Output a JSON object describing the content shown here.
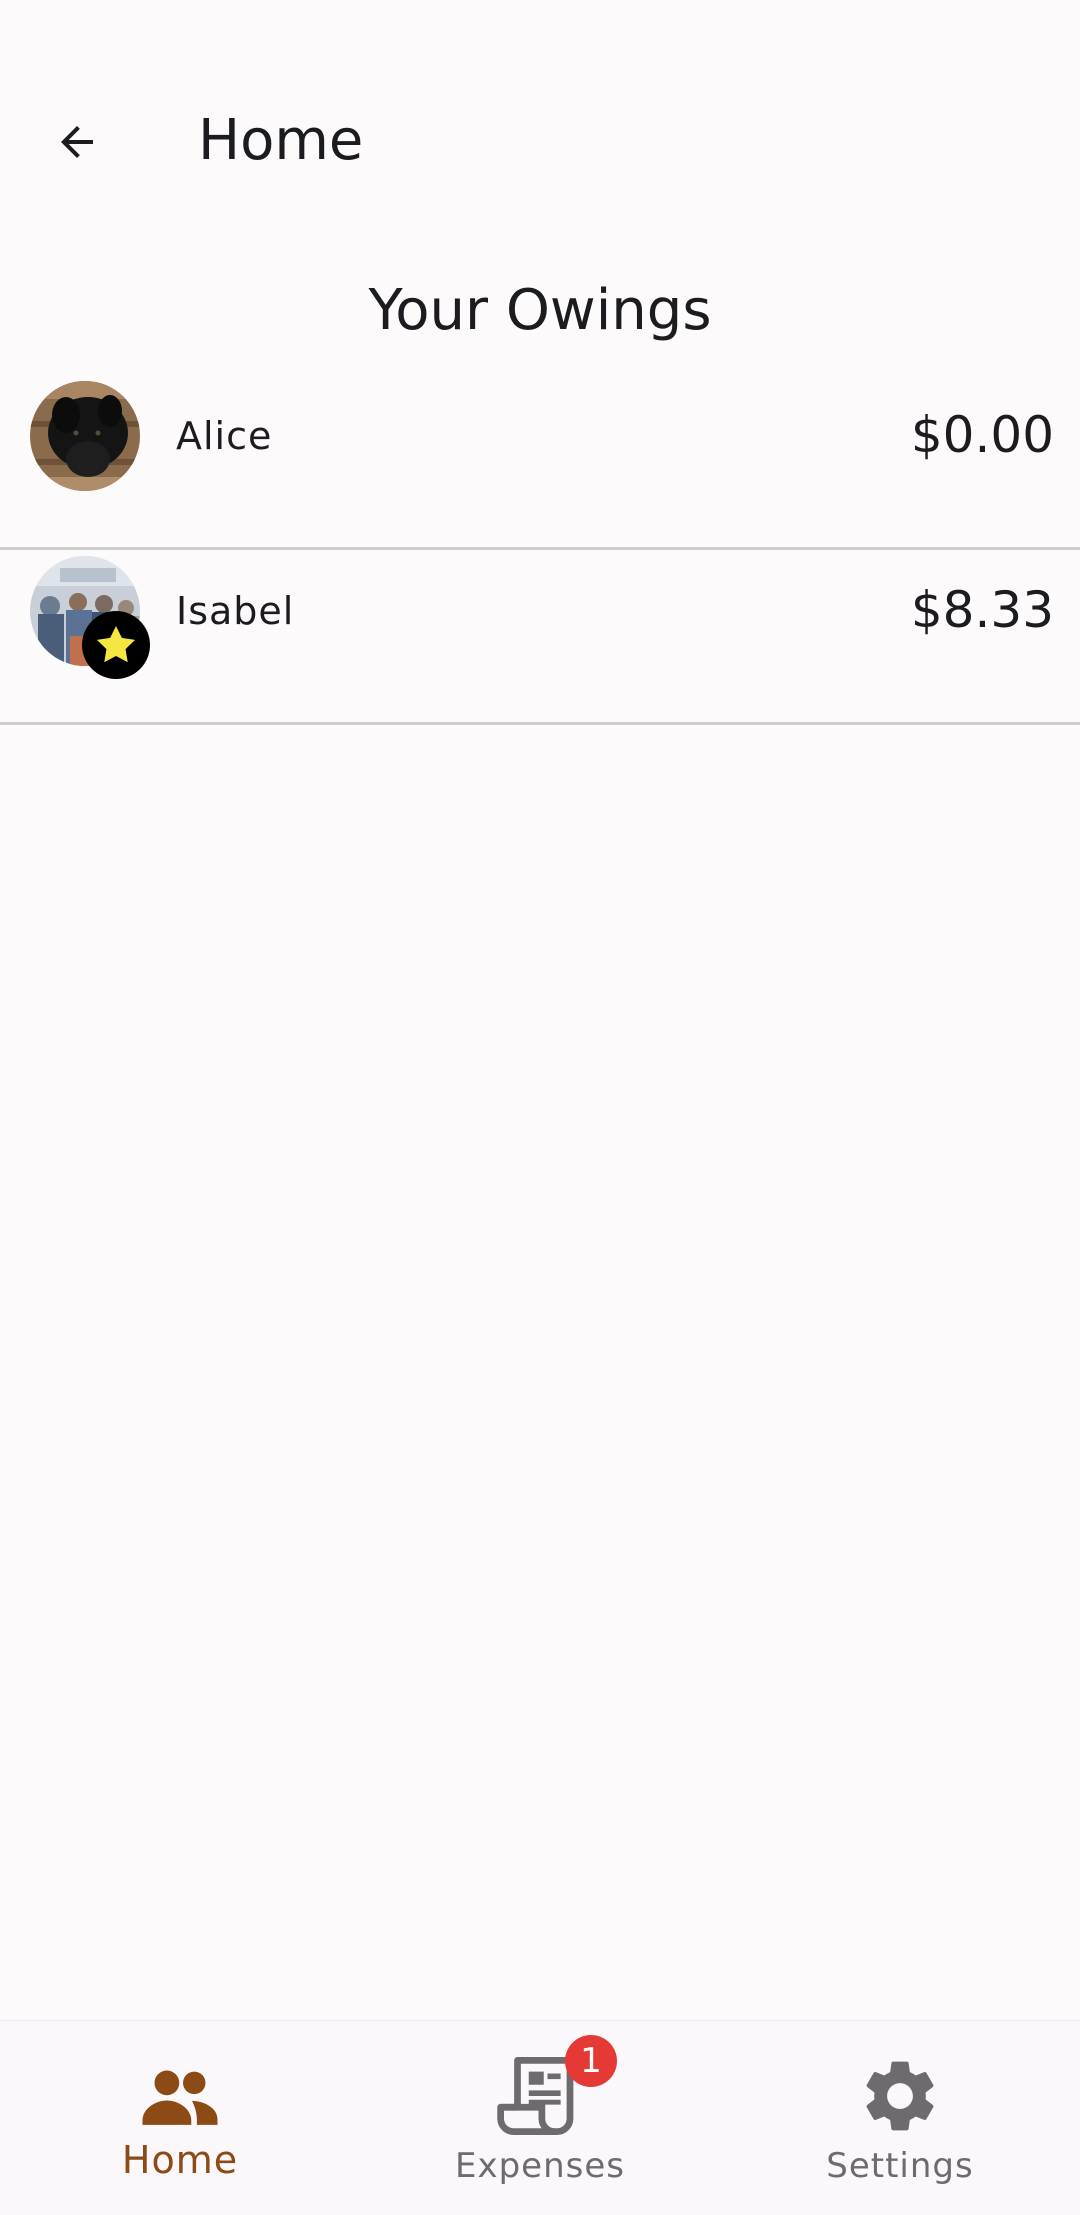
{
  "app_bar": {
    "title": "Home"
  },
  "section": {
    "title": "Your Owings"
  },
  "owings": [
    {
      "name": "Alice",
      "amount": "$0.00",
      "starred": false
    },
    {
      "name": "Isabel",
      "amount": "$8.33",
      "starred": true
    }
  ],
  "bottom_nav": {
    "items": [
      {
        "label": "Home",
        "icon": "people-icon",
        "active": true
      },
      {
        "label": "Expenses",
        "icon": "receipt-icon",
        "active": false,
        "badge": "1"
      },
      {
        "label": "Settings",
        "icon": "gear-icon",
        "active": false
      }
    ]
  },
  "colors": {
    "background": "#fdfafc",
    "active_nav": "#8c4a14",
    "inactive_nav": "#6f6a6e",
    "badge": "#e53935",
    "star": "#f5e642"
  }
}
